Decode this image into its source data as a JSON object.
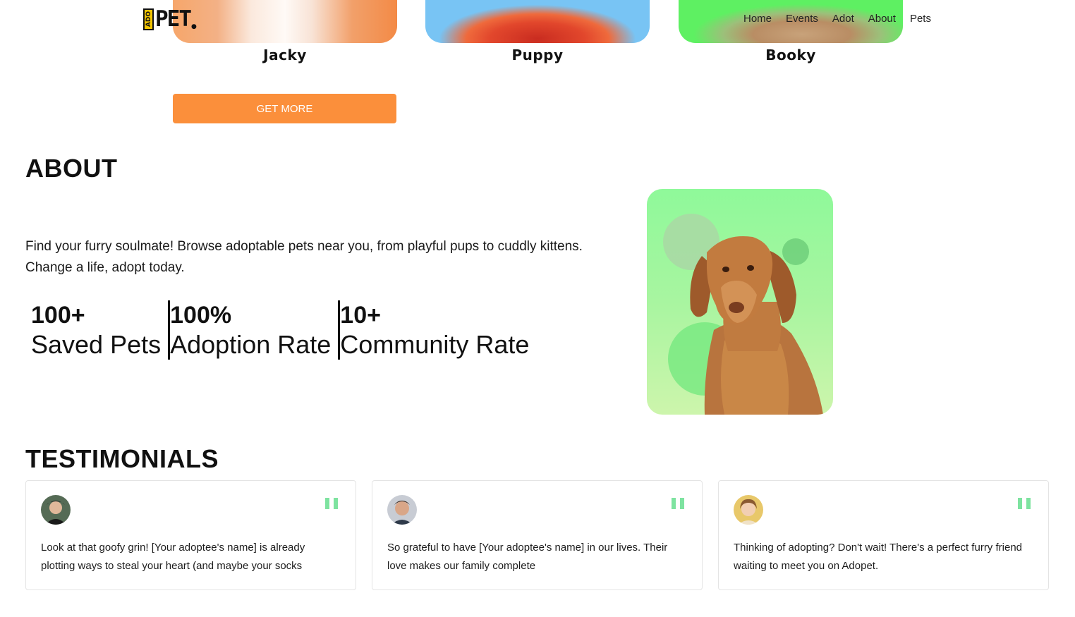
{
  "header": {
    "logo_box_text": "ADO",
    "logo_text": "PET",
    "nav": [
      "Home",
      "Events",
      "Adot",
      "About",
      "Pets"
    ]
  },
  "pets": {
    "cards": [
      {
        "name": "Jacky"
      },
      {
        "name": "Puppy"
      },
      {
        "name": "Booky"
      }
    ],
    "get_more_label": "GET MORE"
  },
  "about": {
    "title": "ABOUT",
    "text": "Find your furry soulmate! Browse adoptable pets near you, from playful pups to cuddly kittens. Change a life, adopt today.",
    "stats": [
      {
        "value": "100+",
        "label": "Saved Pets"
      },
      {
        "value": "100%",
        "label": "Adoption Rate"
      },
      {
        "value": "10+",
        "label": "Community Rate"
      }
    ]
  },
  "testimonials": {
    "title": "TESTIMONIALS",
    "items": [
      {
        "text": "Look at that goofy grin! [Your adoptee's name] is already plotting ways to steal your heart (and maybe your socks"
      },
      {
        "text": "So grateful to have [Your adoptee's name] in our lives. Their love makes our family complete"
      },
      {
        "text": "Thinking of adopting? Don't wait! There's a perfect furry friend waiting to meet you on Adopet."
      }
    ]
  },
  "colors": {
    "accent_orange": "#fb8f3b",
    "quote_green": "#7ee3a0",
    "about_bg_green": "#8ff99a"
  }
}
